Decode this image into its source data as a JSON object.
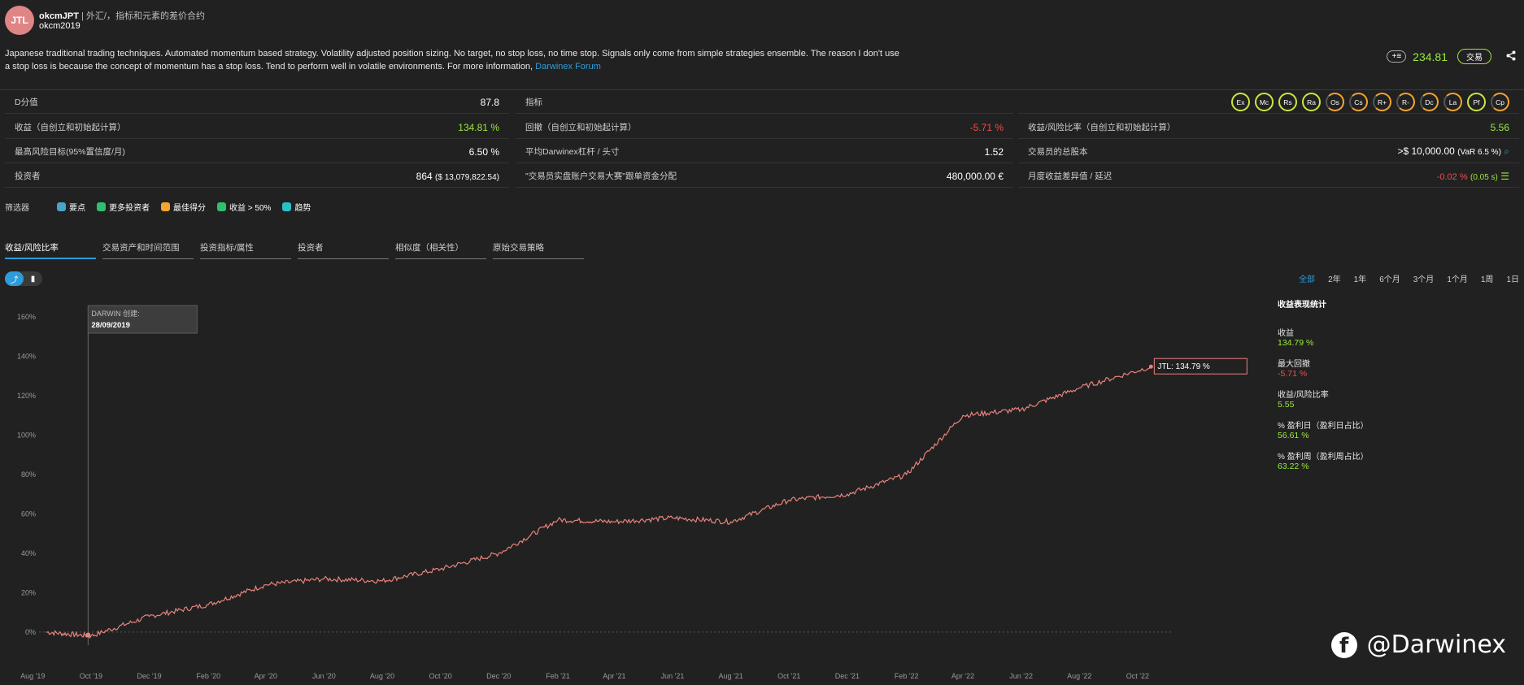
{
  "header": {
    "avatar_text": "JTL",
    "name": "okcmJPT",
    "subtitle": "| 外汇/，指标和元素的差价合约",
    "account": "okcm2019",
    "description": "Japanese traditional trading techniques. Automated momentum based strategy. Volatility adjusted position sizing. No target, no stop loss, no time stop. Signals only come from simple strategies ensemble. The reason I don't use a stop loss is because the concept of momentum has a stop loss. Tend to perform well in volatile environments. For more information, ",
    "link_text": "Darwinex Forum",
    "add_label": "+≡",
    "price": "234.81",
    "trade_label": "交易"
  },
  "stats": {
    "d_score_label": "D分值",
    "d_score": "87.8",
    "indicators_label": "指标",
    "badges": [
      "Ex",
      "Mc",
      "Rs",
      "Ra",
      "Os",
      "Cs",
      "R+",
      "R-",
      "Dc",
      "La",
      "Pf",
      "Cp"
    ],
    "return_label": "收益（自创立和初始起计算）",
    "return": "134.81 %",
    "drawdown_label": "回撤（自创立和初始起计算）",
    "drawdown": "-5.71 %",
    "rr_label": "收益/风险比率（自创立和初始起计算）",
    "rr": "5.56",
    "risk_label": "最高风险目标(95%置信度/月)",
    "risk": "6.50 %",
    "lev_label": "平均Darwinex杠杆 / 头寸",
    "lev": "1.52",
    "capital_label": "交易员的总股本",
    "capital": ">$ 10,000.00",
    "capital_var": "(VaR 6.5 %)",
    "investors_label": "投资者",
    "investors": "864",
    "investors_amount": "($ 13,079,822.54)",
    "alloc_label": "\"交易员实盘账户交易大赛\"跟单资金分配",
    "alloc": "480,000.00 €",
    "monthly_label": "月度收益差异值 / 延迟",
    "monthly": "-0.02 %",
    "monthly_delay": "(0.05 s)"
  },
  "filters": {
    "label": "筛选器",
    "items": [
      {
        "label": "要点",
        "color": "#4aa3c8"
      },
      {
        "label": "更多投资者",
        "color": "#2fbf71"
      },
      {
        "label": "最佳得分",
        "color": "#f3a431"
      },
      {
        "label": "收益 > 50%",
        "color": "#2fbf71"
      },
      {
        "label": "趋势",
        "color": "#2bc0c8"
      }
    ]
  },
  "tabs": [
    "收益/风险比率",
    "交易资产和时间范围",
    "投资指标/属性",
    "投资者",
    "相似度（相关性）",
    "原始交易策略"
  ],
  "ranges": [
    "全部",
    "2年",
    "1年",
    "6个月",
    "3个月",
    "1个月",
    "1周",
    "1日"
  ],
  "side_stats": {
    "title": "收益表现统计",
    "items": [
      {
        "label": "收益",
        "value": "134.79 %",
        "color": "#9be83e"
      },
      {
        "label": "最大回撤",
        "value": "-5.71 %",
        "color": "#f04c4c"
      },
      {
        "label": "收益/风险比率",
        "value": "5.55",
        "color": "#9be83e"
      },
      {
        "label": "% 盈利日（盈利日占比）",
        "value": "56.61 %",
        "color": "#9be83e"
      },
      {
        "label": "% 盈利周（盈利周占比）",
        "value": "63.22 %",
        "color": "#9be83e"
      }
    ]
  },
  "chart_data": {
    "type": "line",
    "series": [
      {
        "name": "JTL",
        "color": "#e8837e"
      }
    ],
    "x": [
      "2019-08-15",
      "2019-10-01",
      "2019-12-01",
      "2020-02-01",
      "2020-04-01",
      "2020-06-01",
      "2020-08-01",
      "2020-10-01",
      "2020-12-01",
      "2021-02-01",
      "2021-04-01",
      "2021-06-01",
      "2021-08-01",
      "2021-10-01",
      "2021-12-01",
      "2022-02-01",
      "2022-04-01",
      "2022-06-01",
      "2022-08-01",
      "2022-10-15"
    ],
    "y": [
      0,
      -2,
      8,
      14,
      24,
      27,
      26,
      32,
      40,
      57,
      56,
      58,
      56,
      67,
      70,
      80,
      110,
      113,
      124,
      134.79
    ],
    "x_tick_labels": [
      "Aug '19",
      "Oct '19",
      "Dec '19",
      "Feb '20",
      "Apr '20",
      "Jun '20",
      "Aug '20",
      "Oct '20",
      "Dec '20",
      "Feb '21",
      "Apr '21",
      "Jun '21",
      "Aug '21",
      "Oct '21",
      "Dec '21",
      "Feb '22",
      "Apr '22",
      "Jun '22",
      "Aug '22",
      "Oct '22"
    ],
    "y_tick_labels": [
      "0%",
      "20%",
      "40%",
      "60%",
      "80%",
      "100%",
      "120%",
      "140%",
      "160%"
    ],
    "ylim": [
      -5,
      165
    ],
    "creation_label": "DARWIN 创建:",
    "creation_date": "28/09/2019",
    "tooltip": "JTL: 134.79 %"
  },
  "watermark": "@Darwinex"
}
